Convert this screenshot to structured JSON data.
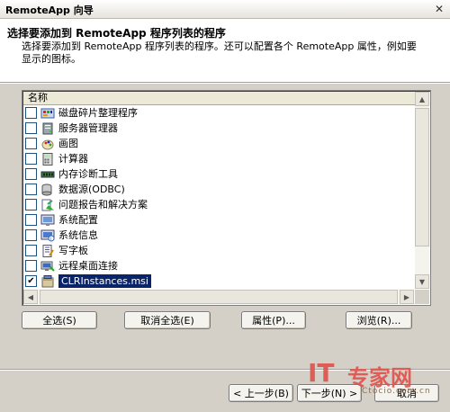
{
  "window": {
    "title": "RemoteApp 向导",
    "close_glyph": "✕"
  },
  "header": {
    "title": "选择要添加到 RemoteApp 程序列表的程序",
    "description": "选择要添加到 RemoteApp 程序列表的程序。还可以配置各个 RemoteApp 属性，例如要显示的图标。"
  },
  "list": {
    "column_header": "名称",
    "items": [
      {
        "label": "磁盘碎片整理程序",
        "checked": false,
        "icon": "defrag-icon"
      },
      {
        "label": "服务器管理器",
        "checked": false,
        "icon": "server-manager-icon"
      },
      {
        "label": "画图",
        "checked": false,
        "icon": "paint-icon"
      },
      {
        "label": "计算器",
        "checked": false,
        "icon": "calculator-icon"
      },
      {
        "label": "内存诊断工具",
        "checked": false,
        "icon": "memory-diagnostic-icon"
      },
      {
        "label": "数据源(ODBC)",
        "checked": false,
        "icon": "odbc-icon"
      },
      {
        "label": "问题报告和解决方案",
        "checked": false,
        "icon": "problem-reports-icon"
      },
      {
        "label": "系统配置",
        "checked": false,
        "icon": "system-config-icon"
      },
      {
        "label": "系统信息",
        "checked": false,
        "icon": "system-info-icon"
      },
      {
        "label": "写字板",
        "checked": false,
        "icon": "wordpad-icon"
      },
      {
        "label": "远程桌面连接",
        "checked": false,
        "icon": "remote-desktop-icon"
      },
      {
        "label": "CLRInstances.msi",
        "checked": true,
        "selected": true,
        "icon": "msi-package-icon"
      }
    ]
  },
  "buttons": {
    "select_all": "全选(S)",
    "deselect_all": "取消全选(E)",
    "properties": "属性(P)...",
    "browse": "浏览(R)...",
    "back": "< 上一步(B)",
    "next": "下一步(N) >",
    "cancel": "取消"
  },
  "watermark": {
    "brand_it": "IT",
    "brand_zh": "专家网",
    "site": "Ctocio.com.cn"
  },
  "colors": {
    "selection": "#0a246a",
    "dialog_bg": "#d4d0c8",
    "watermark": "#e0524b"
  }
}
